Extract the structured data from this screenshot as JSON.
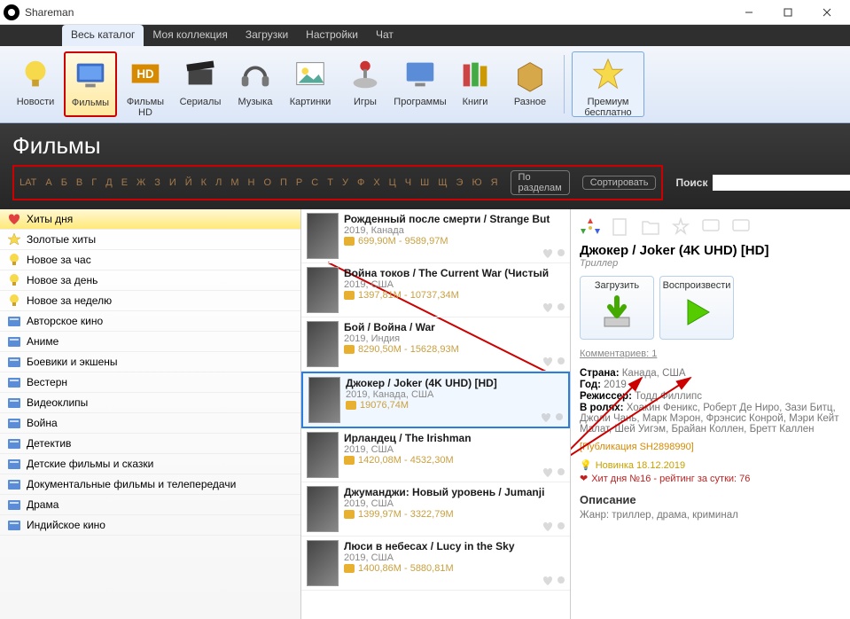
{
  "window": {
    "title": "Shareman"
  },
  "menubar": {
    "items": [
      {
        "label": "Весь каталог",
        "active": true
      },
      {
        "label": "Моя коллекция"
      },
      {
        "label": "Загрузки"
      },
      {
        "label": "Настройки"
      },
      {
        "label": "Чат"
      }
    ]
  },
  "toolbar": {
    "items": [
      {
        "label": "Новости",
        "icon": "bulb"
      },
      {
        "label": "Фильмы",
        "icon": "monitor",
        "active": true,
        "highlight": true
      },
      {
        "label": "Фильмы HD",
        "icon": "hd"
      },
      {
        "label": "Сериалы",
        "icon": "clapper"
      },
      {
        "label": "Музыка",
        "icon": "headphones"
      },
      {
        "label": "Картинки",
        "icon": "picture"
      },
      {
        "label": "Игры",
        "icon": "joystick"
      },
      {
        "label": "Программы",
        "icon": "monitor2"
      },
      {
        "label": "Книги",
        "icon": "books"
      },
      {
        "label": "Разное",
        "icon": "box"
      }
    ],
    "premium": "Премиум бесплатно"
  },
  "section_title": "Фильмы",
  "alphabet": [
    "LAT",
    "А",
    "Б",
    "В",
    "Г",
    "Д",
    "Е",
    "Ж",
    "З",
    "И",
    "Й",
    "К",
    "Л",
    "М",
    "Н",
    "О",
    "П",
    "Р",
    "С",
    "Т",
    "У",
    "Ф",
    "Х",
    "Ц",
    "Ч",
    "Ш",
    "Щ",
    "Э",
    "Ю",
    "Я"
  ],
  "pill_sections": "По разделам",
  "pill_sort": "Сортировать",
  "search_label": "Поиск",
  "sidebar": {
    "items": [
      {
        "label": "Хиты дня",
        "icon": "heart",
        "selected": true
      },
      {
        "label": "Золотые хиты",
        "icon": "star"
      },
      {
        "label": "Новое за час",
        "icon": "bulb"
      },
      {
        "label": "Новое за день",
        "icon": "bulb"
      },
      {
        "label": "Новое за неделю",
        "icon": "bulb"
      },
      {
        "label": "Авторское кино",
        "icon": "folder"
      },
      {
        "label": "Аниме",
        "icon": "folder"
      },
      {
        "label": "Боевики и экшены",
        "icon": "folder"
      },
      {
        "label": "Вестерн",
        "icon": "folder"
      },
      {
        "label": "Видеоклипы",
        "icon": "folder"
      },
      {
        "label": "Война",
        "icon": "folder"
      },
      {
        "label": "Детектив",
        "icon": "folder"
      },
      {
        "label": "Детские фильмы и сказки",
        "icon": "folder"
      },
      {
        "label": "Документальные фильмы и телепередачи",
        "icon": "folder"
      },
      {
        "label": "Драма",
        "icon": "folder"
      },
      {
        "label": "Индийское кино",
        "icon": "folder"
      }
    ]
  },
  "films": [
    {
      "title": "Рожденный после смерти / Strange But",
      "meta": "2019, Канада",
      "size": "699,90M - 9589,97M"
    },
    {
      "title": "Война токов / The Current War (Чистый",
      "meta": "2019, США",
      "size": "1397,81M - 10737,34M"
    },
    {
      "title": "Бой / Война / War",
      "meta": "2019, Индия",
      "size": "8290,50M - 15628,93M"
    },
    {
      "title": "Джокер / Joker (4K UHD) [HD]",
      "meta": "2019, Канада, США",
      "size": "19076,74M",
      "selected": true
    },
    {
      "title": "Ирландец / The Irishman",
      "meta": "2019, США",
      "size": "1420,08M - 4532,30M"
    },
    {
      "title": "Джуманджи: Новый уровень / Jumanji",
      "meta": "2019, США",
      "size": "1399,97M - 3322,79M"
    },
    {
      "title": "Люси в небесах / Lucy in the Sky",
      "meta": "2019, США",
      "size": "1400,86M - 5880,81M"
    }
  ],
  "detail": {
    "title": "Джокер / Joker (4K UHD) [HD]",
    "genre": "Триллер",
    "btn_download": "Загрузить",
    "btn_play": "Воспроизвести",
    "comments": "Комментариев: 1",
    "country_label": "Страна:",
    "country": "Канада, США",
    "year_label": "Год:",
    "year": "2019",
    "director_label": "Режиссер:",
    "director": "Тодд Филлипс",
    "cast_label": "В ролях:",
    "cast": "Хоакин Феникс, Роберт Де Ниро, Зази Битц, Джоли Чань, Марк Мэрон, Фрэнсис Конрой, Мэри Кейт Малат, Шей Уигэм, Брайан Коллен, Бретт Каллен",
    "publication": "[Публикация SH2898990]",
    "novinka": "Новинка 18.12.2019",
    "hit": "Хит дня №16 - рейтинг за сутки: 76",
    "desc_label": "Описание",
    "desc": "Жанр: триллер, драма, криминал"
  }
}
